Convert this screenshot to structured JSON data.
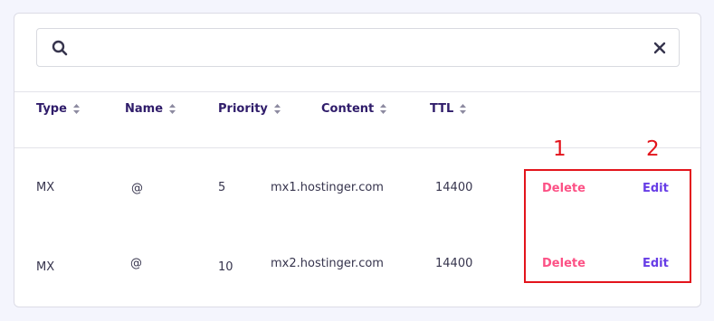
{
  "search": {
    "value": "",
    "placeholder": ""
  },
  "table": {
    "headers": [
      {
        "label": "Type"
      },
      {
        "label": "Name"
      },
      {
        "label": "Priority"
      },
      {
        "label": "Content"
      },
      {
        "label": "TTL"
      }
    ],
    "rows": [
      {
        "type": "MX",
        "name": "@",
        "priority": "5",
        "content": "mx1.hostinger.com",
        "ttl": "14400",
        "delete_label": "Delete",
        "edit_label": "Edit"
      },
      {
        "type": "MX",
        "name": "@",
        "priority": "10",
        "content": "mx2.hostinger.com",
        "ttl": "14400",
        "delete_label": "Delete",
        "edit_label": "Edit"
      }
    ]
  },
  "annotations": {
    "marker_1": "1",
    "marker_2": "2"
  },
  "colors": {
    "delete": "#fc5185",
    "edit": "#673de6",
    "annotation": "#e3141c",
    "text": "#2f1c6a"
  },
  "icons": {
    "search": "search-icon",
    "clear": "close-icon",
    "sort": "sort-icon"
  }
}
